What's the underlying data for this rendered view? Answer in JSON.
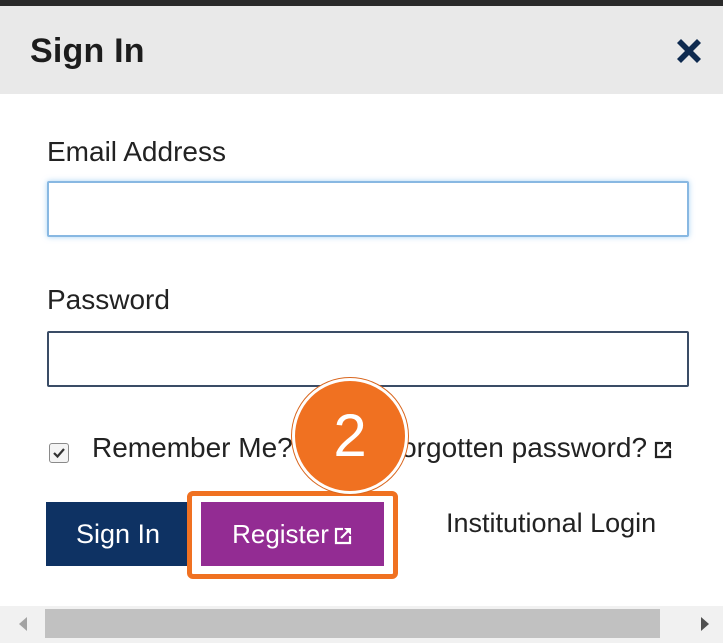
{
  "dialog": {
    "title": "Sign In",
    "close_icon": "close-icon"
  },
  "form": {
    "email_label": "Email Address",
    "email_value": "",
    "email_placeholder": "",
    "password_label": "Password",
    "password_value": "",
    "password_placeholder": "",
    "remember_label": "Remember Me?",
    "remember_checked": true,
    "forgot_link": "Forgotten password?"
  },
  "actions": {
    "signin_label": "Sign In",
    "register_label": "Register",
    "institutional_label": "Institutional Login"
  },
  "annotation": {
    "step_number": "2"
  },
  "icons": {
    "external_link": "external-link-icon",
    "checkbox_check": "check-icon",
    "scroll_left": "scroll-left-arrow-icon",
    "scroll_right": "scroll-right-arrow-icon"
  },
  "colors": {
    "signin_button": "#0e3263",
    "register_button": "#932c93",
    "highlight": "#f07121",
    "header_bg": "#e9e9e9"
  }
}
